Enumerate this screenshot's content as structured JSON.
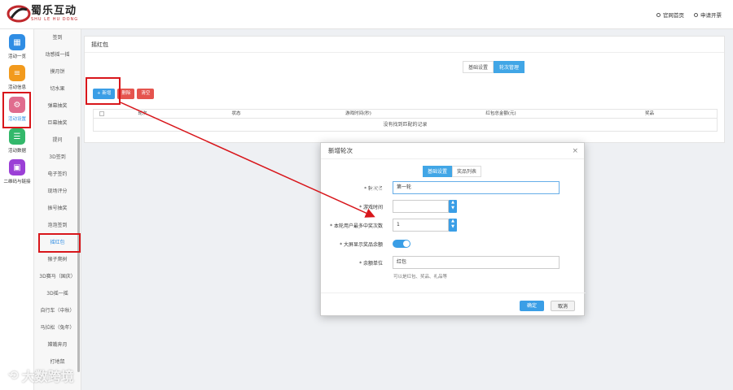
{
  "brand": {
    "name": "蜀乐互动",
    "sub": "SHU LE HU DONG"
  },
  "top_links": {
    "home": "官网首页",
    "apply": "申请开票"
  },
  "rail": [
    {
      "label": "活动一览"
    },
    {
      "label": "活动信息"
    },
    {
      "label": "活动设置"
    },
    {
      "label": "活动数据"
    },
    {
      "label": "二维码与链接"
    }
  ],
  "sub_nav": [
    "签到",
    "动感摇一摇",
    "摸月饼",
    "切水果",
    "弹幕抽奖",
    "巨幕抽奖",
    "提问",
    "3D签到",
    "电子签约",
    "现场评分",
    "振号抽奖",
    "泡泡签到",
    "摇红包",
    "猴子爬树",
    "3D赛马（国庆）",
    "3D摇一摇",
    "自行车（中秋）",
    "马拉松（兔年）",
    "嫦娥奔月",
    "打地鼠"
  ],
  "panel": {
    "title": "摇红包",
    "tabs": [
      "基础设置",
      "轮次管理"
    ],
    "buttons": {
      "add": "+ 新增",
      "delete": "删除",
      "clear": "清空"
    },
    "columns": [
      "轮次",
      "状态",
      "游戏时间(秒)",
      "红包总金额(元)",
      "奖品"
    ],
    "empty": "没有找到匹配的记录"
  },
  "modal": {
    "title": "新增轮次",
    "close": "×",
    "tabs": [
      "基础设置",
      "奖品列表"
    ],
    "fields": {
      "round_name_label": "* 轮次名",
      "round_name_value": "第一轮",
      "game_time_label": "* 游戏时间",
      "max_win_label": "* 本轮用户最多中奖次数",
      "max_win_value": "1",
      "show_remaining_label": "* 大屏显示奖品余额",
      "unit_label": "* 余额单位",
      "unit_value": "红包",
      "unit_hint": "可以是红包、奖品、礼品等"
    },
    "ok": "确定",
    "cancel": "取消"
  },
  "watermark": {
    "main": "大数跨境",
    "logo": "蜀乐互动",
    "logo_sub": "SHU LE HU DONG"
  },
  "colors": {
    "accent": "#3a9ee6",
    "danger": "#e5544e",
    "highlight": "#d8161b"
  }
}
